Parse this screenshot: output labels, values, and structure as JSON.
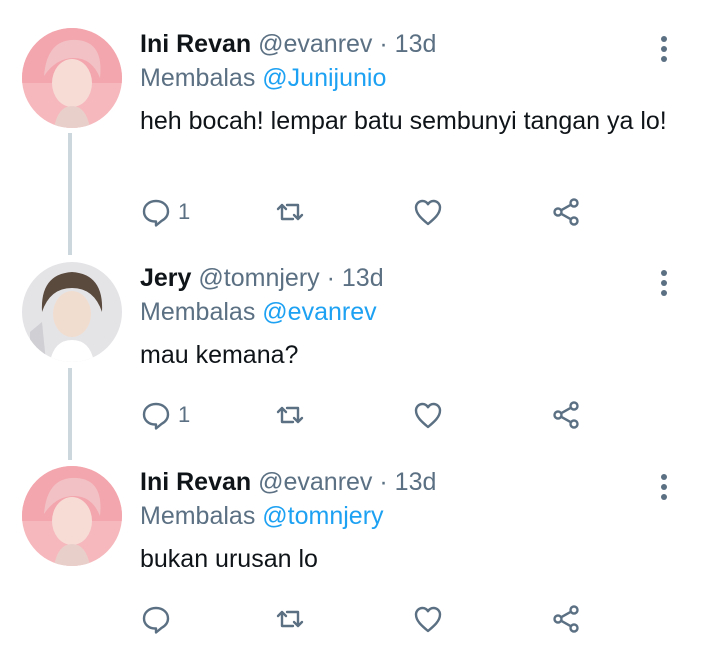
{
  "tweets": [
    {
      "name": "Ini Revan",
      "handle": "@evanrev",
      "sep": "·",
      "time": "13d",
      "reply_prefix": "Membalas",
      "reply_to": "@Junijunio",
      "text": "heh bocah! lempar batu sembunyi tangan ya lo!",
      "reply_count": "1",
      "avatar_color": "#f6b8bd"
    },
    {
      "name": "Jery",
      "handle": "@tomnjery",
      "sep": "·",
      "time": "13d",
      "reply_prefix": "Membalas",
      "reply_to": "@evanrev",
      "text": "mau kemana?",
      "reply_count": "1",
      "avatar_color": "#d9d9dc"
    },
    {
      "name": "Ini Revan",
      "handle": "@evanrev",
      "sep": "·",
      "time": "13d",
      "reply_prefix": "Membalas",
      "reply_to": "@tomnjery",
      "text": "bukan urusan lo",
      "reply_count": "",
      "avatar_color": "#f6b8bd"
    }
  ],
  "colors": {
    "text": "#0f1419",
    "secondary": "#5b7083",
    "accent": "#1da1f2",
    "thread_line": "#ccd6dd"
  },
  "icons": [
    "more-vertical-icon",
    "reply-icon",
    "retweet-icon",
    "like-icon",
    "share-icon"
  ]
}
